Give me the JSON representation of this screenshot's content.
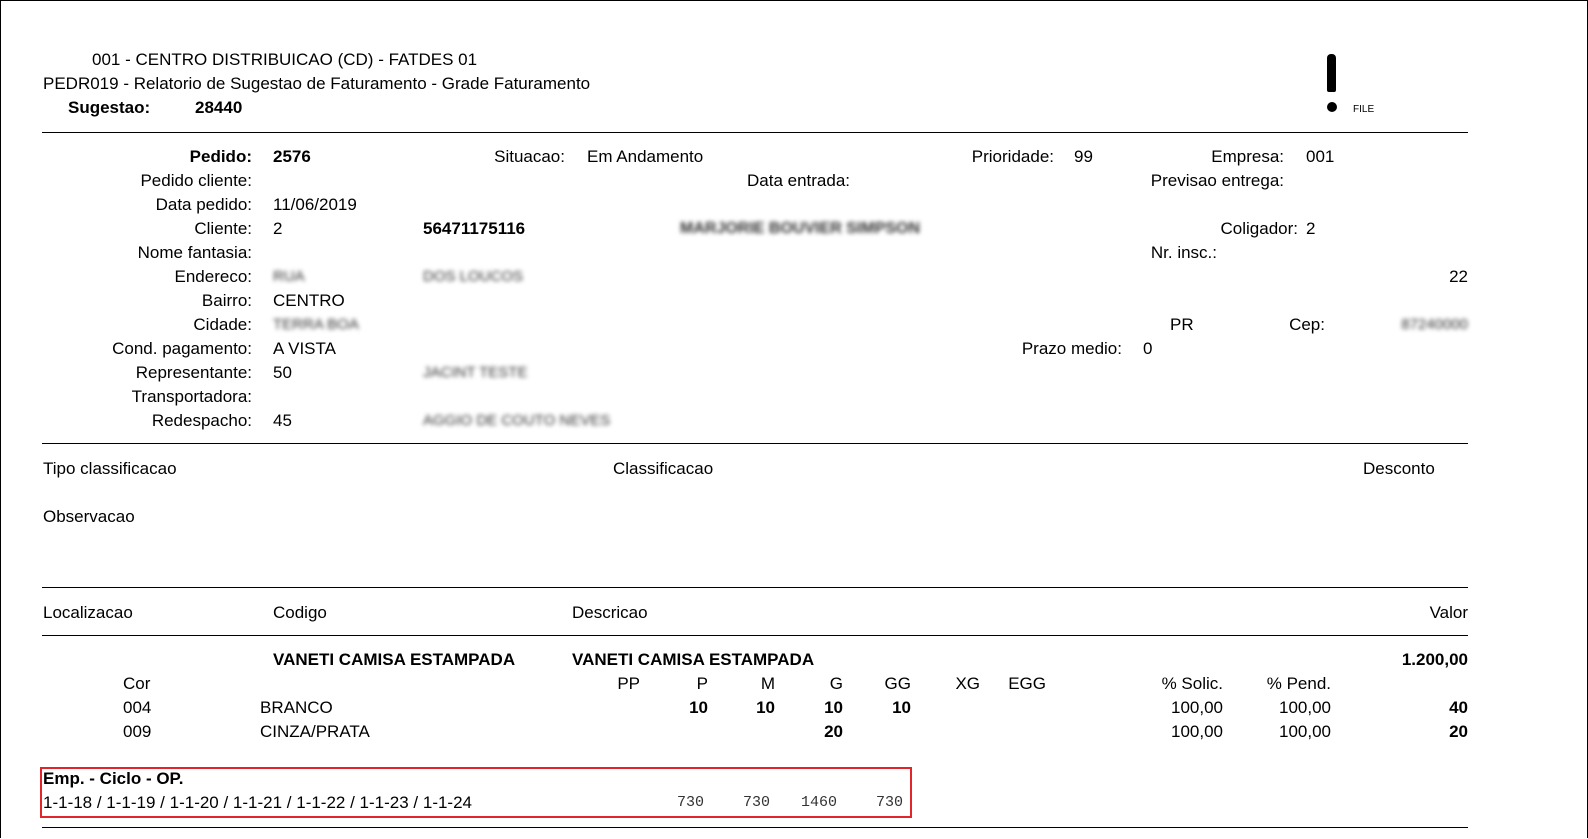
{
  "header": {
    "line1": "001  -   CENTRO DISTRIBUICAO (CD) - FATDES 01",
    "line2": "PEDR019 - Relatorio de Sugestao de Faturamento - Grade Faturamento",
    "sugestao_label": "Sugestao:",
    "sugestao_value": "28440",
    "file_label": "FILE",
    "icon": "exclamation-icon"
  },
  "order": {
    "pedido_label": "Pedido:",
    "pedido_value": "2576",
    "situacao_label": "Situacao:",
    "situacao_value": "Em Andamento",
    "prioridade_label": "Prioridade:",
    "prioridade_value": "99",
    "empresa_label": "Empresa:",
    "empresa_value": "001",
    "pedido_cliente_label": "Pedido cliente:",
    "data_entrada_label": "Data entrada:",
    "previsao_label": "Previsao entrega:",
    "data_pedido_label": "Data pedido:",
    "data_pedido_value": "11/06/2019",
    "cliente_label": "Cliente:",
    "cliente_value": "2",
    "cliente_doc": "56471175116",
    "cliente_nome": "MARJORIE BOUVIER SIMPSON",
    "coligador_label": "Coligador:",
    "coligador_value": "2",
    "nome_fantasia_label": "Nome fantasia:",
    "nr_insc_label": "Nr. insc.:",
    "endereco_label": "Endereco:",
    "endereco_tipo": "RUA",
    "endereco_nome": "DOS LOUCOS",
    "endereco_numero": "22",
    "bairro_label": "Bairro:",
    "bairro_value": "CENTRO",
    "cidade_label": "Cidade:",
    "cidade_value": "TERRA BOA",
    "uf_value": "PR",
    "cep_label": "Cep:",
    "cep_value": "87240000",
    "cond_pag_label": "Cond. pagamento:",
    "cond_pag_value": "A VISTA",
    "prazo_label": "Prazo medio:",
    "prazo_value": "0",
    "representante_label": "Representante:",
    "representante_value": "50",
    "representante_nome": "JACINT TESTE",
    "transportadora_label": "Transportadora:",
    "redespacho_label": "Redespacho:",
    "redespacho_value": "45",
    "redespacho_nome": "AGGIO DE COUTO NEVES"
  },
  "classificacao": {
    "tipo_label": "Tipo classificacao",
    "classificacao_label": "Classificacao",
    "desconto_label": "Desconto",
    "observacao_label": "Observacao"
  },
  "items_header": {
    "localizacao": "Localizacao",
    "codigo": "Codigo",
    "descricao": "Descricao",
    "valor": "Valor"
  },
  "item": {
    "codigo": "VANETI CAMISA ESTAMPADA",
    "descricao": "VANETI CAMISA ESTAMPADA",
    "valor": "1.200,00",
    "cor_label": "Cor",
    "sizes": [
      "PP",
      "P",
      "M",
      "G",
      "GG",
      "XG",
      "EGG"
    ],
    "solic_label": "% Solic.",
    "pend_label": "% Pend.",
    "rows": [
      {
        "cor": "004",
        "nome": "BRANCO",
        "qty": [
          "",
          "10",
          "10",
          "10",
          "10",
          "",
          ""
        ],
        "solic": "100,00",
        "pend": "100,00",
        "total": "40"
      },
      {
        "cor": "009",
        "nome": "CINZA/PRATA",
        "qty": [
          "",
          "",
          "",
          "20",
          "",
          "",
          ""
        ],
        "solic": "100,00",
        "pend": "100,00",
        "total": "20"
      }
    ]
  },
  "op": {
    "title": "Emp. - Ciclo - OP.",
    "list": "1-1-18 / 1-1-19 / 1-1-20 / 1-1-21 / 1-1-22 / 1-1-23 / 1-1-24",
    "totals": [
      "730",
      "730",
      "1460",
      "730"
    ]
  }
}
